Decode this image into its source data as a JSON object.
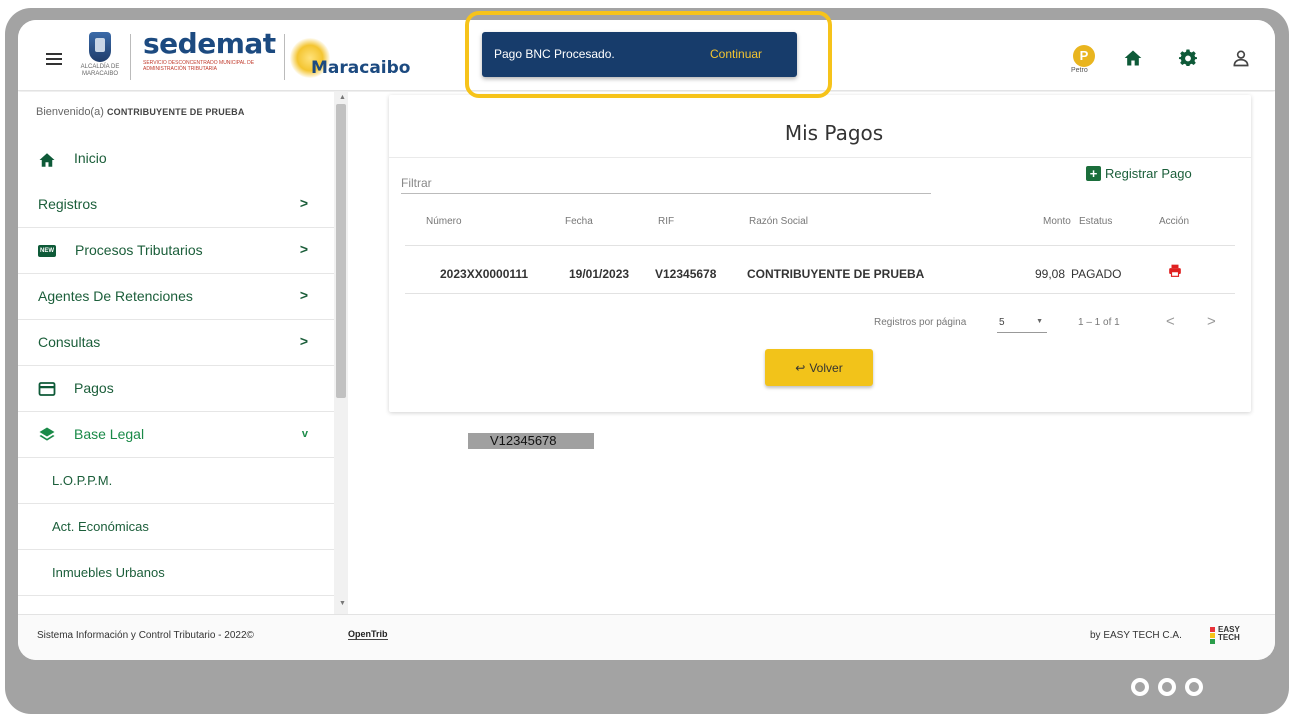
{
  "header": {
    "alcaldia_text": "ALCALDÍA DE MARACAIBO",
    "brand_title": "sedemat",
    "brand_subtitle": "SERVICIO DESCONCENTRADO MUNICIPAL DE ADMINISTRACIÓN TRIBUTARIA",
    "city": "Maracaibo",
    "petro_label": "Petro",
    "icons": [
      "menu-icon",
      "home-icon",
      "gear-icon",
      "user-icon"
    ]
  },
  "notification": {
    "message": "Pago BNC Procesado.",
    "action": "Continuar",
    "highlight_color": "#f6c31a"
  },
  "sidebar": {
    "welcome_prefix": "Bienvenido(a)",
    "welcome_user": "CONTRIBUYENTE DE PRUEBA",
    "items": [
      {
        "label": "Inicio",
        "icon": "home-icon"
      },
      {
        "label": "Registros",
        "chevron": ">"
      },
      {
        "label": "Procesos Tributarios",
        "icon": "new-badge",
        "badge": "NEW",
        "chevron": ">"
      },
      {
        "label": "Agentes De Retenciones",
        "chevron": ">"
      },
      {
        "label": "Consultas",
        "chevron": ">"
      },
      {
        "label": "Pagos",
        "icon": "card-icon"
      },
      {
        "label": "Base Legal",
        "icon": "layers-icon",
        "chevron": "v"
      }
    ],
    "subitems": [
      {
        "label": "L.O.P.P.M."
      },
      {
        "label": "Act. Económicas"
      },
      {
        "label": "Inmuebles Urbanos"
      }
    ]
  },
  "main": {
    "title": "Mis Pagos",
    "filter_placeholder": "Filtrar",
    "register_button": "Registrar Pago",
    "columns": [
      "Número",
      "Fecha",
      "RIF",
      "Razón Social",
      "Monto",
      "Estatus",
      "Acción"
    ],
    "rows": [
      {
        "numero": "2023XX0000111",
        "fecha": "19/01/2023",
        "rif": "V12345678",
        "razon_social": "CONTRIBUYENTE DE PRUEBA",
        "monto": "99,08",
        "estatus": "PAGADO",
        "accion_icon": "printer-icon"
      }
    ],
    "pagination": {
      "rows_per_page_label": "Registros por página",
      "rows_per_page_value": "5",
      "range": "1 – 1 of 1",
      "prev": "<",
      "next": ">"
    },
    "back_button": "Volver",
    "rif_label": "V12345678"
  },
  "footer": {
    "left": "Sistema Información y Control Tributario - 2022©",
    "opentrib": "OpenTrib",
    "right": "by EASY TECH C.A.",
    "logo_text_1": "EASY",
    "logo_text_2": "TECH"
  }
}
